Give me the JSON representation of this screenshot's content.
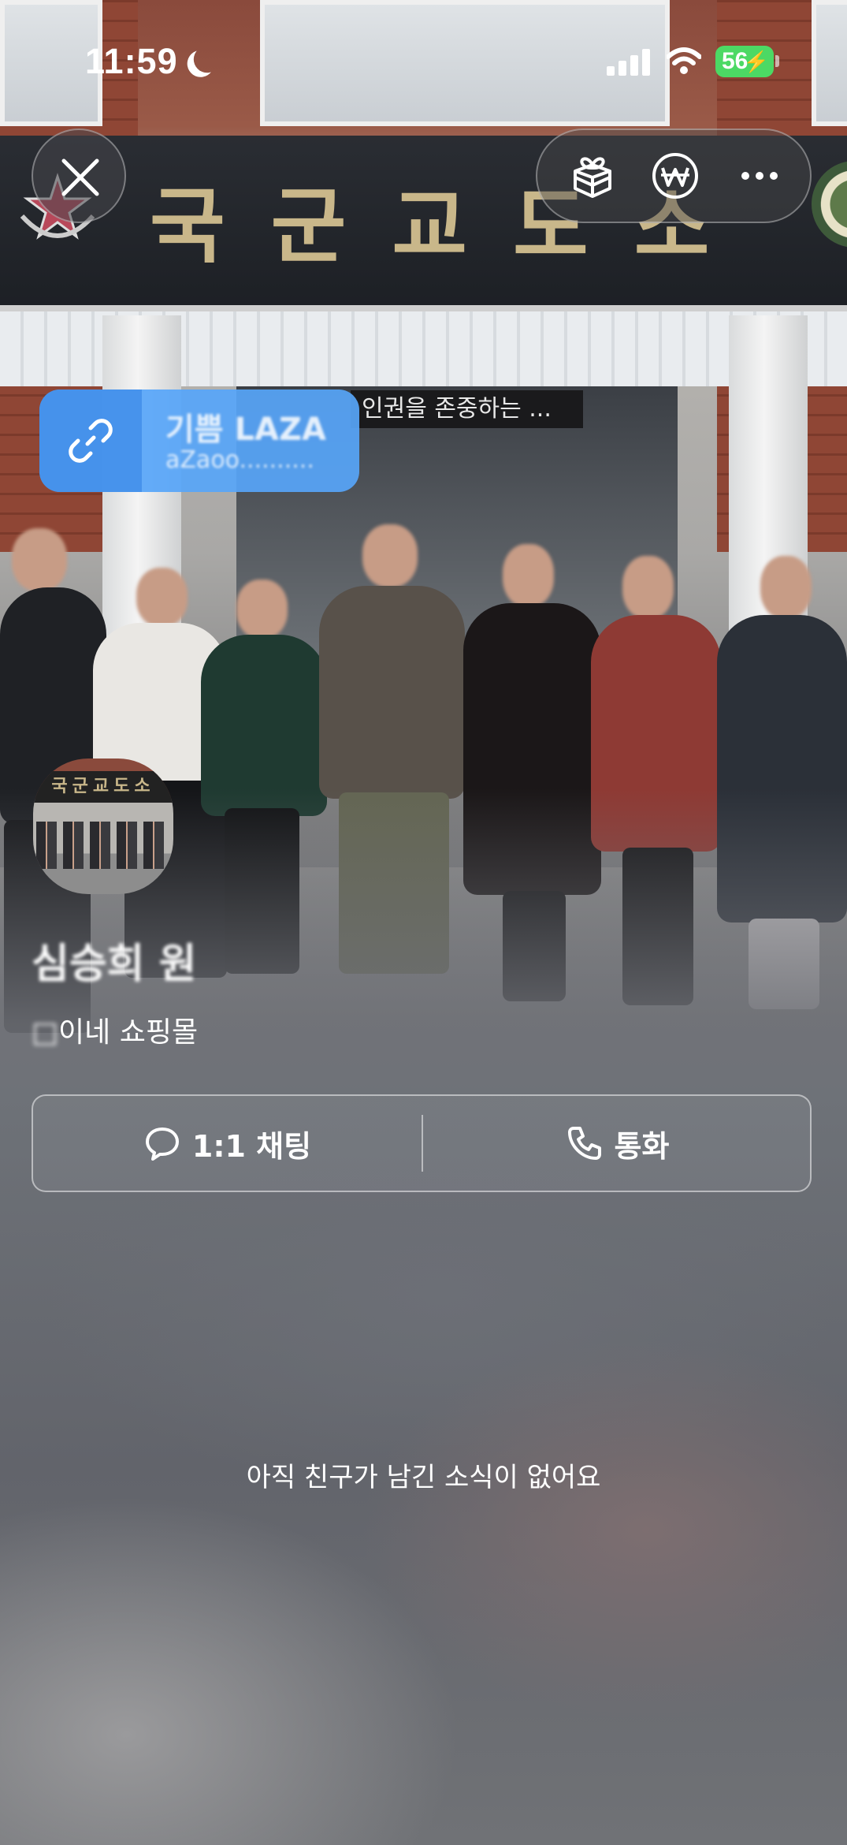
{
  "status_bar": {
    "time": "11:59",
    "battery_level": "56",
    "focus_icon": "moon-icon",
    "signal_icon": "cellular-signal-icon",
    "wifi_icon": "wifi-icon",
    "charging_icon": "bolt-icon"
  },
  "background_photo": {
    "sign_text": "국군교도소",
    "door_sign_text": "인권을 존중하는 ..."
  },
  "top_controls": {
    "close_icon": "close-icon",
    "gift_icon": "gift-box-icon",
    "pay_icon": "won-pay-icon",
    "more_icon": "more-dots-icon"
  },
  "link_card": {
    "icon": "link-icon",
    "title": "기쁨 LAZA",
    "url": "aZaoo.........."
  },
  "profile": {
    "avatar_sign_text": "국군교도소",
    "name": "심승희 원",
    "status_prefix": "□",
    "status_suffix": "이네 쇼핑몰"
  },
  "actions": {
    "chat_icon": "chat-bubble-icon",
    "chat_label": "1:1 채팅",
    "call_icon": "phone-icon",
    "call_label": "통화"
  },
  "feed": {
    "empty_message": "아직 친구가 남긴 소식이 없어요"
  },
  "colors": {
    "link_card": "#57A5F8",
    "battery": "#4CD964",
    "sign_text": "#C9B78A"
  }
}
